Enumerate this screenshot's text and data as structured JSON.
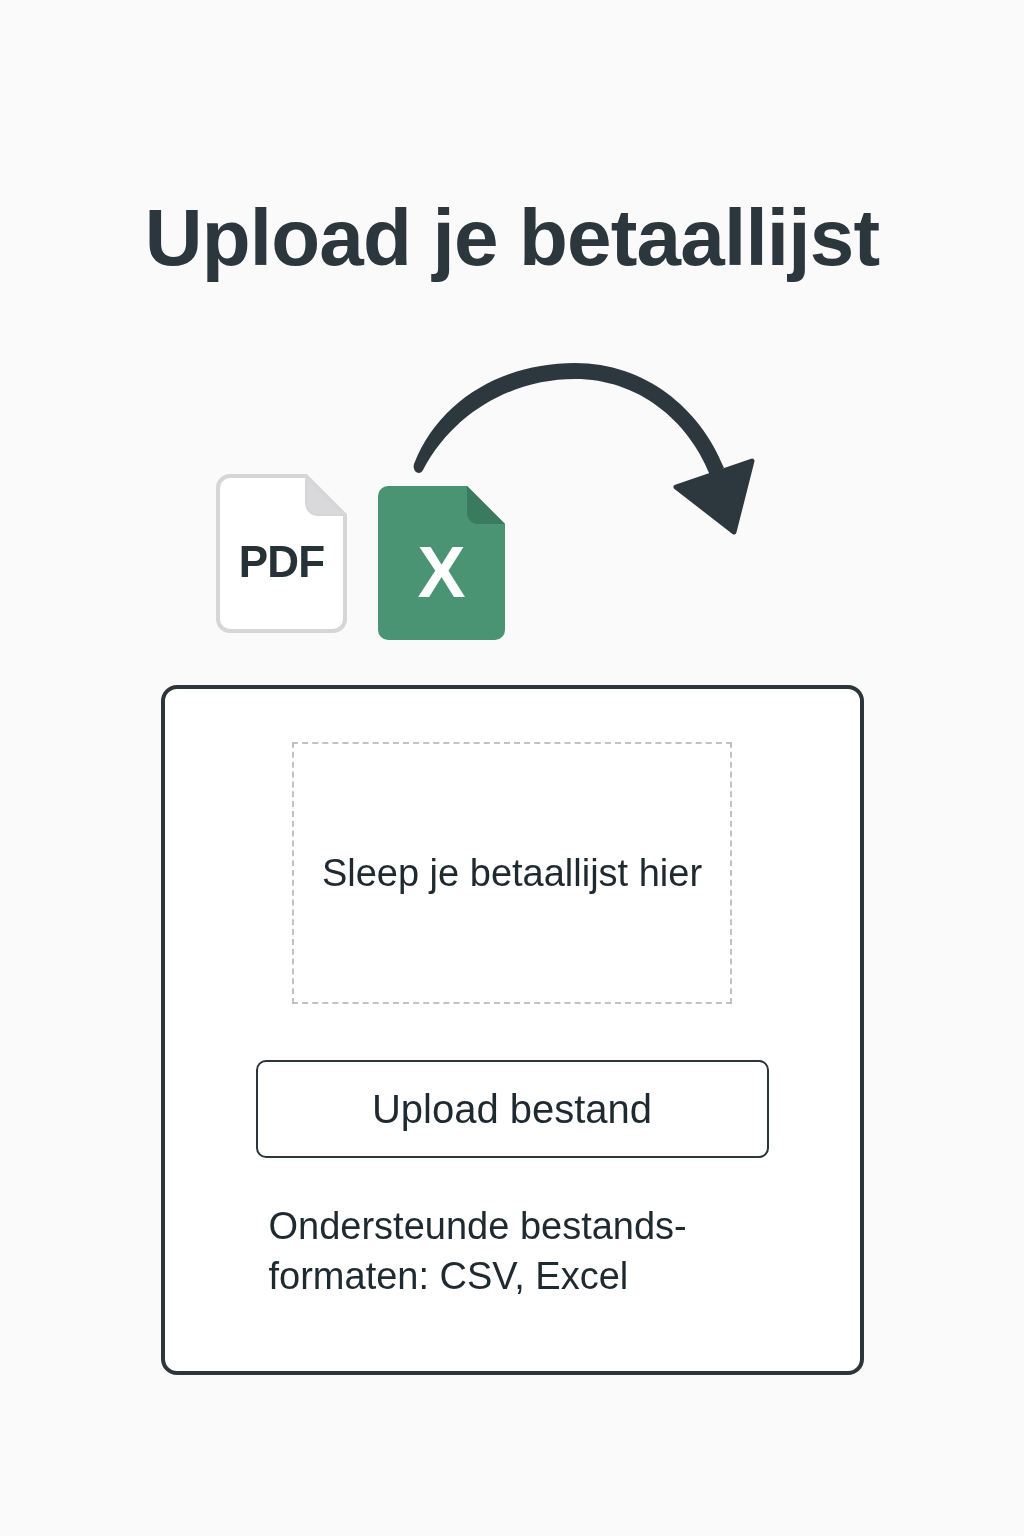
{
  "title": "Upload je betaallijst",
  "illustration": {
    "files": [
      {
        "kind": "pdf",
        "label": "PDF"
      },
      {
        "kind": "spreadsheet",
        "label": "X"
      }
    ]
  },
  "upload_card": {
    "drop_zone": {
      "text": "Sleep je betaallijst hier"
    },
    "button": {
      "label": "Upload bestand"
    },
    "hint": "Ondersteunde bestands-formaten: CSV, Excel"
  }
}
